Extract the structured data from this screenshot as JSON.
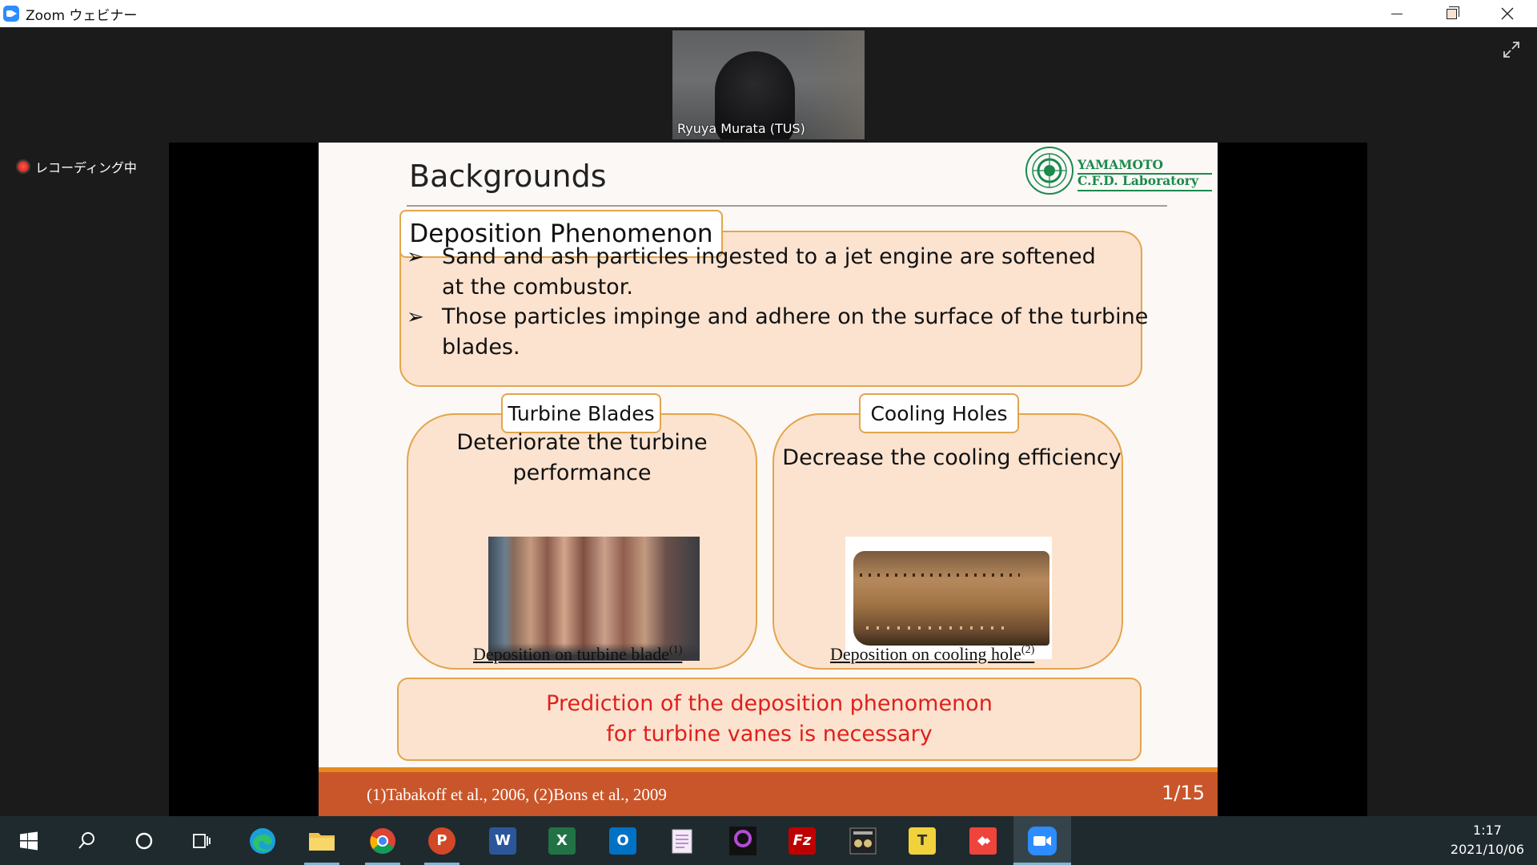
{
  "window": {
    "title": "Zoom ウェビナー"
  },
  "zoom": {
    "participant_name": "Ryuya Murata (TUS)",
    "recording_label": "レコーディング中"
  },
  "slide": {
    "title": "Backgrounds",
    "logo_line1": "YAMAMOTO",
    "logo_line2": "C.F.D. Laboratory",
    "main_box_title": "Deposition Phenomenon",
    "bullets": [
      {
        "line1": "Sand and ash particles ingested to a jet engine are softened",
        "line2": "at the combustor."
      },
      {
        "line1": "Those particles impinge and adhere on the surface of the turbine",
        "line2": "blades."
      }
    ],
    "left_box": {
      "title": "Turbine Blades",
      "text_line1": "Deteriorate the turbine",
      "text_line2": "performance",
      "caption": "Deposition on turbine blade",
      "caption_sup": "(1)"
    },
    "right_box": {
      "title": "Cooling Holes",
      "text": "Decrease the cooling efficiency",
      "caption": "Deposition on cooling hole",
      "caption_sup": "(2)"
    },
    "conclusion_line1": "Prediction of the deposition phenomenon",
    "conclusion_line2": "for turbine vanes is necessary",
    "footer_refs": "(1)Tabakoff et al., 2006,  (2)Bons et al., 2009",
    "page_number": "1/15",
    "colors": {
      "box_fill": "#fbe3d0",
      "box_border": "#e3a54a",
      "conclusion_text": "#e0201a",
      "footer_bg": "#c9562a",
      "logo_green": "#1b8a4e"
    }
  },
  "taskbar": {
    "apps": [
      {
        "name": "start-icon"
      },
      {
        "name": "search-icon"
      },
      {
        "name": "cortana-icon"
      },
      {
        "name": "task-view-icon"
      },
      {
        "name": "edge-icon"
      },
      {
        "name": "file-explorer-icon"
      },
      {
        "name": "chrome-icon"
      },
      {
        "name": "powerpoint-icon",
        "letter": "P"
      },
      {
        "name": "word-icon",
        "letter": "W"
      },
      {
        "name": "excel-icon",
        "letter": "X"
      },
      {
        "name": "outlook-icon",
        "letter": "O"
      },
      {
        "name": "notepad-icon"
      },
      {
        "name": "nikon-icon"
      },
      {
        "name": "filezilla-icon",
        "letter": "Fz"
      },
      {
        "name": "app-icon"
      },
      {
        "name": "text-editor-icon",
        "letter": "T"
      },
      {
        "name": "anydesk-icon"
      },
      {
        "name": "zoom-icon"
      }
    ],
    "clock_time": "1:17",
    "clock_date": "2021/10/06"
  }
}
